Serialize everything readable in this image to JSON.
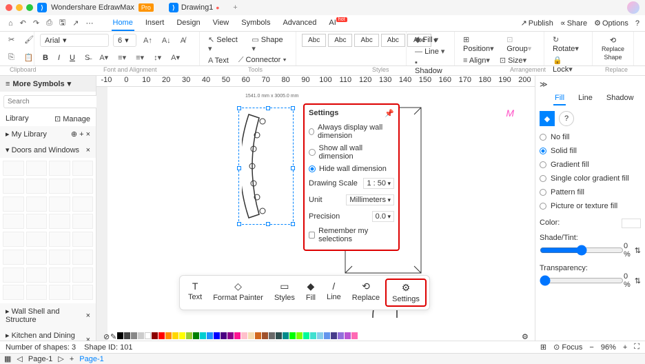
{
  "app": {
    "name": "Wondershare EdrawMax",
    "badge": "Pro",
    "doc": "Drawing1"
  },
  "menu": {
    "tabs": [
      "Home",
      "Insert",
      "Design",
      "View",
      "Symbols",
      "Advanced",
      "AI"
    ],
    "right": {
      "publish": "Publish",
      "share": "Share",
      "options": "Options"
    }
  },
  "ribbon": {
    "font": "Arial",
    "size": "6",
    "select": "Select",
    "shape": "Shape",
    "text": "Text",
    "connector": "Connector",
    "fill": "Fill",
    "line": "Line",
    "shadow": "Shadow",
    "position": "Position",
    "align": "Align",
    "group": "Group",
    "size_btn": "Size",
    "rotate": "Rotate",
    "lock": "Lock",
    "replace": "Replace\nShape",
    "groups": {
      "clipboard": "Clipboard",
      "font": "Font and Alignment",
      "tools": "Tools",
      "styles": "Styles",
      "arrangement": "Arrangement",
      "replace": "Replace"
    }
  },
  "sidebar": {
    "more": "More Symbols",
    "search_ph": "Search",
    "search_btn": "Search",
    "library": "Library",
    "manage": "Manage",
    "mylib": "My Library",
    "section": "Doors and Windows",
    "wall_section": "Wall Shell and Structure",
    "kitchen_section": "Kitchen and Dining Room"
  },
  "settings": {
    "title": "Settings",
    "opt1": "Always display wall dimension",
    "opt2": "Show all wall dimension",
    "opt3": "Hide wall dimension",
    "scale_l": "Drawing Scale",
    "scale_v": "1 : 50",
    "unit_l": "Unit",
    "unit_v": "Millimeters",
    "prec_l": "Precision",
    "prec_v": "0.0",
    "remember": "Remember my selections"
  },
  "float": {
    "text": "Text",
    "format": "Format\nPainter",
    "styles": "Styles",
    "fill": "Fill",
    "line": "Line",
    "replace": "Replace",
    "settings": "Settings"
  },
  "rpanel": {
    "tabs": [
      "Fill",
      "Line",
      "Shadow"
    ],
    "nofill": "No fill",
    "solid": "Solid fill",
    "gradient": "Gradient fill",
    "single": "Single color gradient fill",
    "pattern": "Pattern fill",
    "picture": "Picture or texture fill",
    "color": "Color:",
    "shade": "Shade/Tint:",
    "trans": "Transparency:",
    "pct": "0 %"
  },
  "status": {
    "shapes": "Number of shapes: 3",
    "shapeid": "Shape ID: 101",
    "focus": "Focus",
    "zoom": "96%"
  },
  "page": {
    "p1": "Page-1",
    "p2": "Page-1"
  },
  "ruler": [
    "-10",
    "0",
    "10",
    "20",
    "30",
    "40",
    "50",
    "60",
    "70",
    "80",
    "90",
    "100",
    "110",
    "120",
    "130",
    "140",
    "150",
    "160",
    "170",
    "180",
    "190",
    "200"
  ],
  "sel_dim": "1541.0 mm x 3005.0 mm"
}
